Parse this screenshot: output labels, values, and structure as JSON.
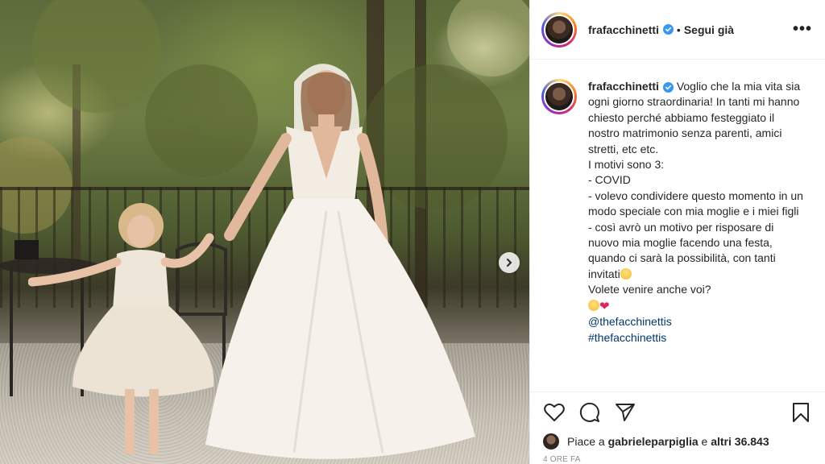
{
  "post": {
    "username": "frafacchinetti",
    "follow_status": "Segui già",
    "separator": "•"
  },
  "caption": {
    "username": "frafacchinetti",
    "text": "Voglio che la mia vita sia ogni giorno straordinaria! In tanti mi hanno chiesto perché abbiamo festeggiato il nostro matrimonio senza parenti, amici stretti, etc etc.\nI motivi sono 3:\n- COVID\n- volevo condividere questo momento in un modo speciale con mia moglie e i miei figli\n- così avrò un motivo per risposare di nuovo mia moglie facendo una festa, quando ci sarà la possibilità, con tanti invitati",
    "question": "Volete venire anche voi?",
    "tags": [
      "@thefacchinettis",
      "#thefacchinettis"
    ]
  },
  "likes": {
    "prefix": "Piace a",
    "user": "gabrieleparpiglia",
    "middle": "e",
    "others": "altri 36.843"
  },
  "time": "4 ORE FA",
  "icons": {
    "more": "more-options-icon",
    "verified": "verified-badge-icon",
    "next": "chevron-right-icon",
    "like": "heart-icon",
    "comment": "comment-icon",
    "share": "paper-plane-icon",
    "save": "bookmark-icon"
  },
  "colors": {
    "link": "#00376b",
    "verified": "#3897f0",
    "text": "#262626",
    "muted": "#8e8e8e"
  }
}
